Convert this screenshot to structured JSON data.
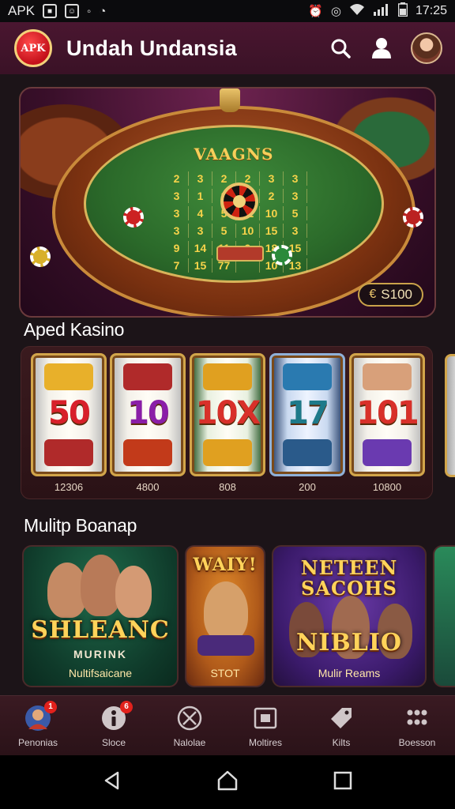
{
  "status_bar": {
    "carrier": "APK",
    "time": "17:25"
  },
  "header": {
    "logo_text": "APK",
    "title": "Undah Undansia",
    "icons": [
      "search-icon",
      "user-icon",
      "avatar"
    ]
  },
  "hero": {
    "table_title": "VAAGNS",
    "felt_numbers": [
      "2",
      "3",
      "2",
      "2",
      "3",
      "3",
      "3",
      "1",
      "2",
      "2",
      "2",
      "3",
      "3",
      "4",
      "5",
      "12",
      "10",
      "5",
      "3",
      "3",
      "5",
      "10",
      "15",
      "3",
      "9",
      "14",
      "11",
      "9",
      "18",
      "15",
      "7",
      "15",
      "77",
      "",
      "10",
      "13"
    ],
    "price_badge": {
      "currency_icon": "coin-icon",
      "amount": "S100"
    }
  },
  "sections": {
    "slots_title": "Aped Kasino",
    "games_title": "Mulitp Boanap"
  },
  "slots": [
    {
      "number": "50",
      "color": "#d8202a",
      "caption": "12306"
    },
    {
      "number": "10",
      "color": "#8a1ea8",
      "caption": "4800"
    },
    {
      "number": "10X",
      "color": "#d8302a",
      "caption": "808"
    },
    {
      "number": "17",
      "color": "#1e7a8a",
      "caption": "200"
    },
    {
      "number": "101",
      "color": "#d8302a",
      "caption": "10800"
    }
  ],
  "games": [
    {
      "title": "SHLEANC",
      "subtitle": "MURINK",
      "footer": "Nultifsaicane"
    },
    {
      "title": "WAIY!",
      "subtitle": "",
      "footer": "STOT"
    },
    {
      "title": "NETEEN SACOHS",
      "subtitle": "NIBLIO",
      "footer": "Mulir Reams"
    }
  ],
  "bottom_nav": [
    {
      "icon": "profile-icon",
      "label": "Penonias",
      "badge": "1"
    },
    {
      "icon": "info-icon",
      "label": "Sloce",
      "badge": "6"
    },
    {
      "icon": "crossed-circle-icon",
      "label": "Nalolae",
      "badge": ""
    },
    {
      "icon": "frame-icon",
      "label": "Moltires",
      "badge": ""
    },
    {
      "icon": "tag-icon",
      "label": "Kilts",
      "badge": ""
    },
    {
      "icon": "grid-icon",
      "label": "Boesson",
      "badge": ""
    }
  ],
  "colors": {
    "header_bg": "#4a1630",
    "accent_gold": "#e9c36a",
    "page_bg": "#1c1418",
    "badge_red": "#e2211c"
  }
}
